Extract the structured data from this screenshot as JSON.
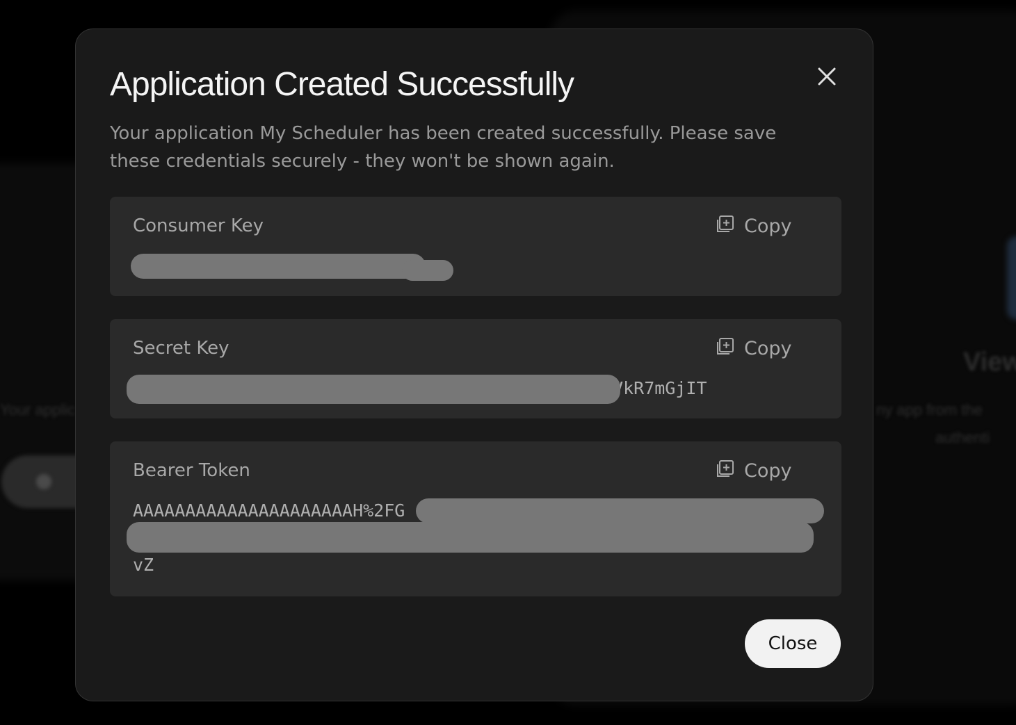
{
  "background": {
    "texts": [
      "Your applic",
      "View",
      "ny app from the",
      "authenti"
    ]
  },
  "modal": {
    "title": "Application Created Successfully",
    "description": "Your application My Scheduler has been created successfully. Please save these credentials securely - they won't be shown again.",
    "close_icon": "close-icon",
    "close_button_label": "Close"
  },
  "credentials": [
    {
      "label": "Consumer Key",
      "value": "",
      "copy_label": "Copy",
      "copy_icon": "copy-icon"
    },
    {
      "label": "Secret Key",
      "value": "5VkR7mGjIT",
      "copy_label": "Copy",
      "copy_icon": "copy-icon"
    },
    {
      "label": "Bearer Token",
      "value_line1": "AAAAAAAAAAAAAAAAAAAAAH%2FG",
      "value_line2": "",
      "value_line3": "vZ",
      "copy_label": "Copy",
      "copy_icon": "copy-icon"
    }
  ],
  "colors": {
    "modal_bg": "#1a1a1a",
    "card_bg": "#2a2a2a",
    "redaction": "#777777",
    "close_button_bg": "#f2f2f2"
  }
}
